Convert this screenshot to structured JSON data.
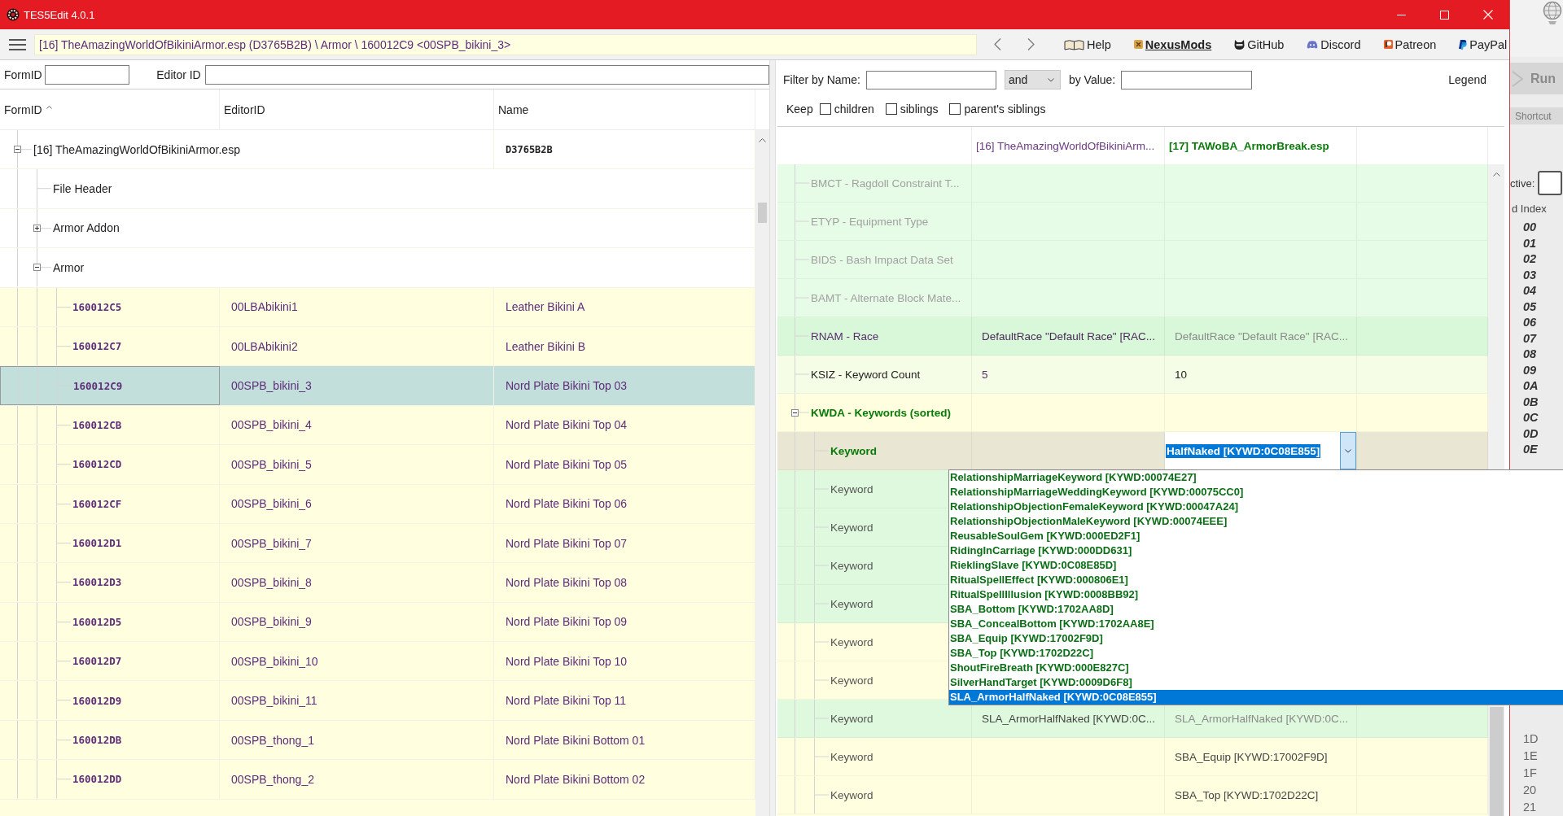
{
  "window": {
    "title": "TES5Edit 4.0.1"
  },
  "toolbar": {
    "path": "[16] TheAmazingWorldOfBikiniArmor.esp (D3765B2B) \\ Armor \\ 160012C9 <00SPB_bikini_3>",
    "links": [
      {
        "kind": "help",
        "label": "Help",
        "highlighted": false
      },
      {
        "kind": "nexus",
        "label": "NexusMods",
        "highlighted": true
      },
      {
        "kind": "github",
        "label": "GitHub",
        "highlighted": false
      },
      {
        "kind": "discord",
        "label": "Discord",
        "highlighted": false
      },
      {
        "kind": "patreon",
        "label": "Patreon",
        "highlighted": false
      },
      {
        "kind": "paypal",
        "label": "PayPal",
        "highlighted": false
      }
    ]
  },
  "search": {
    "form_id_label": "FormID",
    "editor_id_label": "Editor ID"
  },
  "tree": {
    "columns": [
      {
        "label": "FormID",
        "sorted": true
      },
      {
        "label": "EditorID",
        "sorted": false
      },
      {
        "label": "Name",
        "sorted": false
      }
    ],
    "nodes": [
      {
        "kind": "file",
        "label": "[16] TheAmazingWorldOfBikiniArmor.esp",
        "name": "D3765B2B",
        "expanded": true,
        "selected": false,
        "children": [
          {
            "kind": "group",
            "label": "File Header",
            "selected": false
          },
          {
            "kind": "group",
            "label": "Armor Addon",
            "expanded": false,
            "selected": false
          },
          {
            "kind": "group",
            "label": "Armor",
            "expanded": true,
            "selected": false,
            "children": [
              {
                "kind": "record",
                "form_id": "160012C5",
                "editor_id": "00LBAbikini1",
                "name": "Leather Bikini A",
                "selected": false
              },
              {
                "kind": "record",
                "form_id": "160012C7",
                "editor_id": "00LBAbikini2",
                "name": "Leather Bikini B",
                "selected": false
              },
              {
                "kind": "record",
                "form_id": "160012C9",
                "editor_id": "00SPB_bikini_3",
                "name": "Nord Plate Bikini Top 03",
                "selected": true
              },
              {
                "kind": "record",
                "form_id": "160012CB",
                "editor_id": "00SPB_bikini_4",
                "name": "Nord Plate Bikini Top 04",
                "selected": false
              },
              {
                "kind": "record",
                "form_id": "160012CD",
                "editor_id": "00SPB_bikini_5",
                "name": "Nord Plate Bikini Top 05",
                "selected": false
              },
              {
                "kind": "record",
                "form_id": "160012CF",
                "editor_id": "00SPB_bikini_6",
                "name": "Nord Plate Bikini Top 06",
                "selected": false
              },
              {
                "kind": "record",
                "form_id": "160012D1",
                "editor_id": "00SPB_bikini_7",
                "name": "Nord Plate Bikini Top 07",
                "selected": false
              },
              {
                "kind": "record",
                "form_id": "160012D3",
                "editor_id": "00SPB_bikini_8",
                "name": "Nord Plate Bikini Top 08",
                "selected": false
              },
              {
                "kind": "record",
                "form_id": "160012D5",
                "editor_id": "00SPB_bikini_9",
                "name": "Nord Plate Bikini Top 09",
                "selected": false
              },
              {
                "kind": "record",
                "form_id": "160012D7",
                "editor_id": "00SPB_bikini_10",
                "name": "Nord Plate Bikini Top 10",
                "selected": false
              },
              {
                "kind": "record",
                "form_id": "160012D9",
                "editor_id": "00SPB_bikini_11",
                "name": "Nord Plate Bikini Top 11",
                "selected": false
              },
              {
                "kind": "record",
                "form_id": "160012DB",
                "editor_id": "00SPB_thong_1",
                "name": "Nord Plate Bikini Bottom 01",
                "selected": false
              },
              {
                "kind": "record",
                "form_id": "160012DD",
                "editor_id": "00SPB_thong_2",
                "name": "Nord Plate Bikini Bottom 02",
                "selected": false
              }
            ]
          }
        ]
      }
    ]
  },
  "filter": {
    "name_label": "Filter by Name:",
    "operator": "and",
    "value_label": "by Value:",
    "legend": "Legend",
    "keep_label": "Keep",
    "keep_options": [
      {
        "label": "children",
        "checked": false
      },
      {
        "label": "siblings",
        "checked": false
      },
      {
        "label": "parent's siblings",
        "checked": false
      }
    ]
  },
  "record_view": {
    "columns": [
      {
        "label": "[16] TheAmazingWorldOfBikiniArm...",
        "kind": "master"
      },
      {
        "label": "[17] TAWoBA_ArmorBreak.esp",
        "kind": "winner"
      }
    ],
    "rows": [
      {
        "kind": "field",
        "label": {
          "text": "BMCT - Ragdoll Constraint T...",
          "color": "#a0a0a0"
        },
        "color": "#e7fce7",
        "selected": false
      },
      {
        "kind": "field",
        "label": {
          "text": "ETYP - Equipment Type",
          "color": "#a0a0a0"
        },
        "color": "#e7fce7",
        "selected": false
      },
      {
        "kind": "field",
        "label": {
          "text": "BIDS - Bash Impact Data Set",
          "color": "#a0a0a0"
        },
        "color": "#e7fce7",
        "selected": false
      },
      {
        "kind": "field",
        "label": {
          "text": "BAMT - Alternate Block Mate...",
          "color": "#a0a0a0"
        },
        "color": "#e7fce7",
        "selected": false
      },
      {
        "kind": "field",
        "label": {
          "text": "RNAM - Race",
          "color": "#5a2d6e"
        },
        "color": "#d9f7d9",
        "selected": false,
        "cells": [
          {
            "text": "DefaultRace \"Default Race\" [RAC...",
            "color": "#4a2a5a"
          },
          {
            "text": "DefaultRace \"Default Race\" [RAC...",
            "color": "#8a8a8a"
          }
        ]
      },
      {
        "kind": "field",
        "label": {
          "text": "KSIZ - Keyword Count",
          "color": "#222222"
        },
        "color": "#f6fde6",
        "selected": false,
        "cells": [
          {
            "text": "5",
            "color": "#5a2d6e"
          },
          {
            "text": "10",
            "color": "#222222"
          }
        ]
      },
      {
        "kind": "group",
        "label": {
          "text": "KWDA - Keywords (sorted)",
          "color": "#0a7a0a"
        },
        "color": "#ffffe0",
        "selected": false,
        "expanded": true,
        "children": [
          {
            "kind": "field",
            "label": {
              "text": "Keyword",
              "color": "#0a7a0a"
            },
            "selected": true,
            "editor": {
              "value": "HalfNaked [KYWD:0C08E855]",
              "options": [
                {
                  "text": "RelationshipMarriageKeyword [KYWD:00074E27]",
                  "selected": false
                },
                {
                  "text": "RelationshipMarriageWeddingKeyword [KYWD:00075CC0]",
                  "selected": false
                },
                {
                  "text": "RelationshipObjectionFemaleKeyword [KYWD:00047A24]",
                  "selected": false
                },
                {
                  "text": "RelationshipObjectionMaleKeyword [KYWD:00074EEE]",
                  "selected": false
                },
                {
                  "text": "ReusableSoulGem [KYWD:000ED2F1]",
                  "selected": false
                },
                {
                  "text": "RidingInCarriage [KYWD:000DD631]",
                  "selected": false
                },
                {
                  "text": "RieklingSlave [KYWD:0C08E85D]",
                  "selected": false
                },
                {
                  "text": "RitualSpellEffect [KYWD:000806E1]",
                  "selected": false
                },
                {
                  "text": "RitualSpellIllusion [KYWD:0008BB92]",
                  "selected": false
                },
                {
                  "text": "SBA_Bottom [KYWD:1702AA8D]",
                  "selected": false
                },
                {
                  "text": "SBA_ConcealBottom [KYWD:1702AA8E]",
                  "selected": false
                },
                {
                  "text": "SBA_Equip [KYWD:17002F9D]",
                  "selected": false
                },
                {
                  "text": "SBA_Top [KYWD:1702D22C]",
                  "selected": false
                },
                {
                  "text": "ShoutFireBreath [KYWD:000E827C]",
                  "selected": false
                },
                {
                  "text": "SilverHandTarget [KYWD:0009D6F8]",
                  "selected": false
                },
                {
                  "text": "SLA_ArmorHalfNaked [KYWD:0C08E855]",
                  "selected": true
                }
              ]
            }
          },
          {
            "kind": "field",
            "label": {
              "text": "Keyword",
              "color": "#555555"
            },
            "color": "#dff9df",
            "selected": false
          },
          {
            "kind": "field",
            "label": {
              "text": "Keyword",
              "color": "#555555"
            },
            "color": "#dff9df",
            "selected": false
          },
          {
            "kind": "field",
            "label": {
              "text": "Keyword",
              "color": "#555555"
            },
            "color": "#dff9df",
            "selected": false
          },
          {
            "kind": "field",
            "label": {
              "text": "Keyword",
              "color": "#555555"
            },
            "color": "#dff9df",
            "selected": false
          },
          {
            "kind": "field",
            "label": {
              "text": "Keyword",
              "color": "#555555"
            },
            "color": "#ffffe0",
            "selected": false
          },
          {
            "kind": "field",
            "label": {
              "text": "Keyword",
              "color": "#555555"
            },
            "color": "#ffffe0",
            "selected": false
          },
          {
            "kind": "field",
            "label": {
              "text": "Keyword",
              "color": "#555555"
            },
            "color": "#dff9df",
            "selected": false,
            "cells": [
              {
                "text": "SLA_ArmorHalfNaked [KYWD:0C...",
                "color": "#444444"
              },
              {
                "text": "SLA_ArmorHalfNaked [KYWD:0C...",
                "color": "#8a8a8a"
              }
            ]
          },
          {
            "kind": "field",
            "label": {
              "text": "Keyword",
              "color": "#555555"
            },
            "color": "#ffffe0",
            "selected": false,
            "cells": [
              null,
              {
                "text": "SBA_Equip [KYWD:17002F9D]",
                "color": "#444444"
              }
            ]
          },
          {
            "kind": "field",
            "label": {
              "text": "Keyword",
              "color": "#555555"
            },
            "color": "#ffffe0",
            "selected": false,
            "cells": [
              null,
              {
                "text": "SBA_Top [KYWD:1702D22C]",
                "color": "#444444"
              }
            ]
          }
        ]
      }
    ]
  },
  "background_window": {
    "run_label": "Run",
    "tab_label": "Shortcut",
    "active_label": "ctive:",
    "index_header": "d Index",
    "index_groups": [
      [
        {
          "text": "00",
          "active": true
        },
        {
          "text": "01",
          "active": true
        },
        {
          "text": "02",
          "active": true
        },
        {
          "text": "03",
          "active": true
        },
        {
          "text": "04",
          "active": true
        },
        {
          "text": "05",
          "active": true
        },
        {
          "text": "06",
          "active": true
        },
        {
          "text": "07",
          "active": true
        },
        {
          "text": "08",
          "active": true
        },
        {
          "text": "09",
          "active": true
        },
        {
          "text": "0A",
          "active": true
        },
        {
          "text": "0B",
          "active": true
        },
        {
          "text": "0C",
          "active": true
        },
        {
          "text": "0D",
          "active": true
        },
        {
          "text": "0E",
          "active": true
        }
      ],
      [
        {
          "text": "1D",
          "active": false
        },
        {
          "text": "1E",
          "active": false
        },
        {
          "text": "1F",
          "active": false
        },
        {
          "text": "20",
          "active": false
        },
        {
          "text": "21",
          "active": false
        }
      ]
    ]
  }
}
